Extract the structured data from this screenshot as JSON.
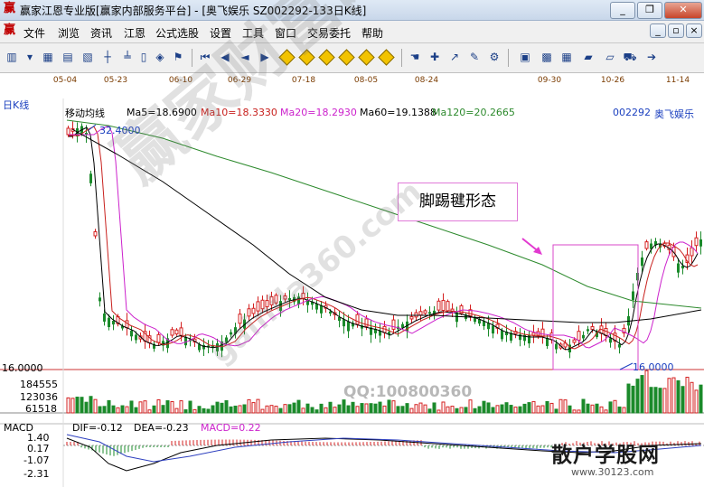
{
  "window": {
    "title": "赢家江恩专业版[赢家内部服务平台] - [奥飞娱乐 SZ002292-133日K线]",
    "minimize": "_",
    "restore": "❐",
    "close": "✕"
  },
  "menu": {
    "items": [
      "文件",
      "浏览",
      "资讯",
      "江恩",
      "公式选股",
      "设置",
      "工具",
      "窗口",
      "交易委托",
      "帮助"
    ],
    "mdi_buttons": [
      "_",
      "▫",
      "×"
    ]
  },
  "chart": {
    "period": "日K线",
    "dates": [
      "05-04",
      "05-23",
      "06-10",
      "06-29",
      "07-18",
      "08-05",
      "08-24",
      "09-30",
      "10-26",
      "11-14"
    ],
    "indicator_name": "移动均线",
    "ma": [
      {
        "label": "Ma5=18.6900",
        "color": "#000000"
      },
      {
        "label": "Ma10=18.3330",
        "color": "#c8201d"
      },
      {
        "label": "Ma20=18.2930",
        "color": "#cc22cc"
      },
      {
        "label": "Ma60=19.1388",
        "color": "#000000"
      },
      {
        "label": "Ma120=20.2665",
        "color": "#2d8a2d"
      }
    ],
    "stock_code": "002292",
    "stock_name": "奥飞娱乐",
    "high_label": "32.4000",
    "low_label": "16.0000",
    "low_axis": "16.0000",
    "volume_axis": [
      "184555",
      "123036",
      "61518"
    ],
    "annotation": "脚踢毽形态",
    "macd": {
      "name": "MACD",
      "dif": "DIF=-0.12",
      "dea": "DEA=-0.23",
      "macd": "MACD=0.22",
      "axis": [
        "1.40",
        "0.17",
        "-1.07",
        "-2.31"
      ]
    }
  },
  "watermark": {
    "main": "赢家财富网",
    "url": "gainila360.com",
    "qq": "QQ:100800360",
    "brand": "散户学股网",
    "brand_url": "www.30123.com"
  }
}
